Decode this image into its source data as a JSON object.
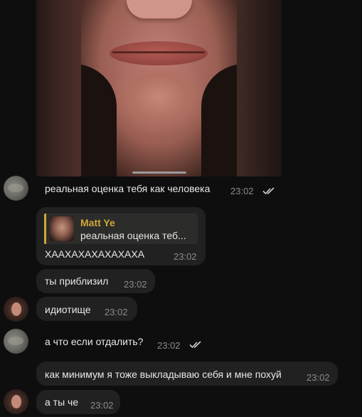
{
  "messages": [
    {
      "id": "m1",
      "text": "реальная оценка тебя как человека",
      "time": "23:02",
      "read": true
    },
    {
      "id": "m2",
      "reply": {
        "name": "Matt Ye",
        "preview": "реальная оценка теб..."
      },
      "text": "ХААХАХАХАХАХАХА",
      "time": "23:02"
    },
    {
      "id": "m3",
      "text": "ты приблизил",
      "time": "23:02"
    },
    {
      "id": "m4",
      "text": "идиотище",
      "time": "23:02"
    },
    {
      "id": "m5",
      "text": "а что если отдалить?",
      "time": "23:02",
      "read": true
    },
    {
      "id": "m6",
      "text": "как минимум я тоже выкладываю себя и мне похуй",
      "time": "23:02"
    },
    {
      "id": "m7",
      "text": "а ты че",
      "time": "23:02"
    }
  ],
  "colors": {
    "background": "#0e0e0e",
    "bubble": "#212121",
    "reply_accent": "#d2a63a",
    "timestamp": "#8b8b8b"
  },
  "icons": [
    "double-check-icon"
  ]
}
